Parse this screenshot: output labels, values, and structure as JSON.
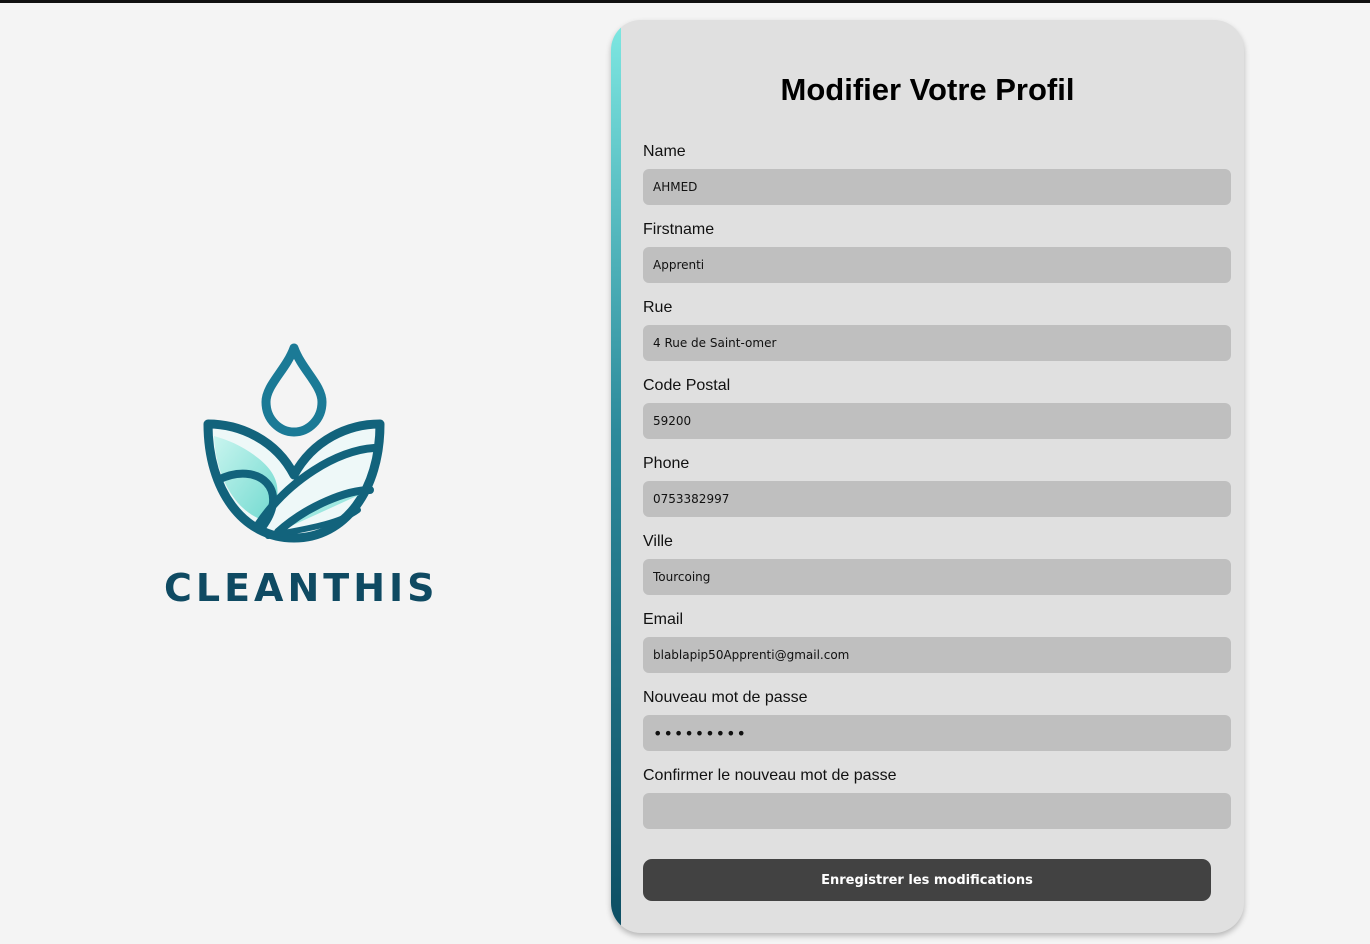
{
  "brand": {
    "name": "CLEANTHIS",
    "colors": {
      "primary": "#0f4a62",
      "accent": "#7ee8e2",
      "mid": "#1f7f99"
    }
  },
  "form": {
    "title": "Modifier Votre Profil",
    "fields": [
      {
        "label": "Name",
        "value": "AHMED",
        "type": "text"
      },
      {
        "label": "Firstname",
        "value": "Apprenti",
        "type": "text"
      },
      {
        "label": "Rue",
        "value": "4 Rue de Saint-omer",
        "type": "text"
      },
      {
        "label": "Code Postal",
        "value": "59200",
        "type": "text"
      },
      {
        "label": "Phone",
        "value": "0753382997",
        "type": "text"
      },
      {
        "label": "Ville",
        "value": "Tourcoing",
        "type": "text"
      },
      {
        "label": "Email",
        "value": "blablapip50Apprenti@gmail.com",
        "type": "email"
      },
      {
        "label": "Nouveau mot de passe",
        "value": "123456789",
        "type": "password"
      },
      {
        "label": "Confirmer le nouveau mot de passe",
        "value": "",
        "type": "password"
      }
    ],
    "submit_label": "Enregistrer les modifications"
  },
  "colors": {
    "page_bg": "#f4f4f4",
    "card_bg": "#e0e0e0",
    "input_bg": "#bfbfbf",
    "button_bg": "#424242"
  }
}
